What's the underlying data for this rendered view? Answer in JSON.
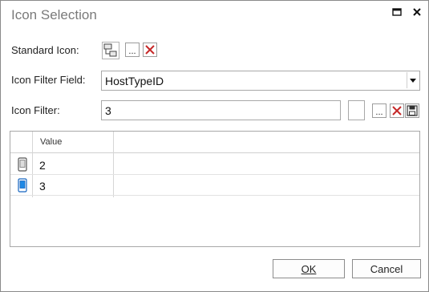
{
  "dialog": {
    "title": "Icon Selection"
  },
  "form": {
    "standard_icon_label": "Standard Icon:",
    "browse_label": "...",
    "icon_filter_field_label": "Icon Filter Field:",
    "icon_filter_field_value": "HostTypeID",
    "icon_filter_label": "Icon Filter:",
    "icon_filter_value": "3"
  },
  "grid": {
    "columns": [
      "Value"
    ],
    "rows": [
      {
        "value": "2",
        "icon": "mobile-phone-gray-icon"
      },
      {
        "value": "3",
        "icon": "mobile-phone-blue-icon"
      }
    ]
  },
  "footer": {
    "ok_label": "OK",
    "cancel_label": "Cancel"
  },
  "colors": {
    "delete_red": "#c62828",
    "selected_blue": "#1565c0"
  }
}
